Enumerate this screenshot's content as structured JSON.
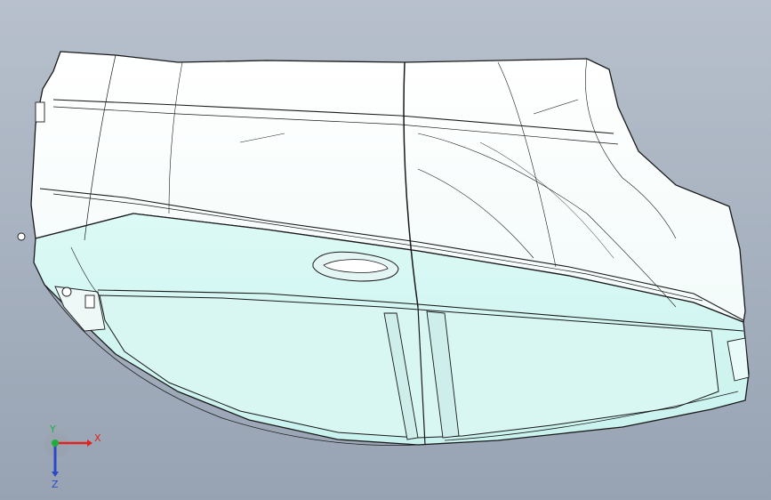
{
  "viewport": {
    "background_top": "#b7c0cc",
    "background_bottom": "#97a3b3",
    "model": {
      "part": "door-outer-panel",
      "face_color": "#e6fbf9",
      "face_color_lower": "#d2f5f1",
      "edge_color": "#1a1a1a"
    }
  },
  "triad": {
    "x_label": "X",
    "y_label": "Y",
    "z_label": "Z",
    "x_color": "#e0231c",
    "y_color": "#1fae3c",
    "z_color": "#2a49c8"
  }
}
